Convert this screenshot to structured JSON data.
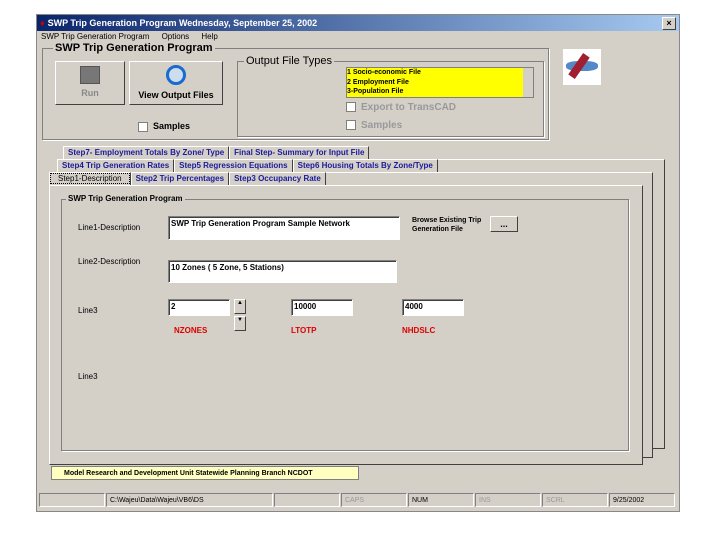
{
  "window": {
    "title": "SWP Trip Generation Program Wednesday, September 25, 2002",
    "close": "×"
  },
  "menu": [
    "SWP Trip Generation Program",
    "Options",
    "Help"
  ],
  "main_group": {
    "title": "SWP Trip Generation Program",
    "run": "Run",
    "view_output": "View Output Files",
    "samples": "Samples"
  },
  "output_group": {
    "title": "Output File Types",
    "items": [
      "1 Socio-economic File",
      "2 Employment File",
      "3-Population File"
    ],
    "export": "Export to TransCAD",
    "samples": "Samples",
    "list_bg": "#ffff00"
  },
  "tabs": {
    "row1": [
      "Step7- Employment Totals By Zone/ Type",
      "Final Step- Summary for Input File"
    ],
    "row2": [
      "Step4 Trip Generation Rates",
      "Step5 Regression Equations",
      "Step6 Housing Totals By Zone/Type"
    ],
    "row3": [
      "Step1-Description",
      "Step2 Trip Percentages",
      "Step3  Occupancy Rate"
    ]
  },
  "form": {
    "group_title": "SWP Trip Generation Program",
    "line1_label": "Line1-Description",
    "line1_value": "SWP Trip Generation Program Sample Network",
    "browse_label": "Browse Existing Trip Generation File",
    "browse_button": "...",
    "line2_label": "Line2-Description",
    "line2_value": "10 Zones ( 5 Zone, 5 Stations)",
    "line3_label": "Line3",
    "nzones": "2",
    "ltotp": "10000",
    "nhdslc": "4000",
    "nzones_label": "NZONES",
    "ltotp_label": "LTOTP",
    "nhdslc_label": "NHDSLC",
    "line4_label": "Line3"
  },
  "footer": "Model Research and Development Unit Statewide Planning Branch  NCDOT",
  "status": [
    "",
    "C:\\Wajeu\\Data\\Wajeu\\VB6\\DS",
    "",
    "CAPS",
    "NUM",
    "INS",
    "SCRL",
    "9/25/2002"
  ]
}
